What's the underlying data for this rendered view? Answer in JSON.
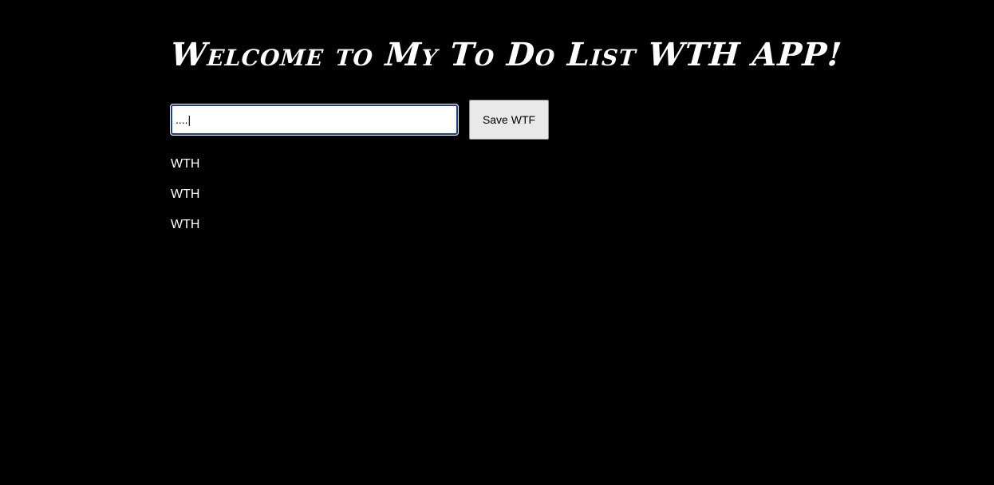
{
  "header": {
    "title": "Welcome to My To Do List WTH APP!"
  },
  "form": {
    "input_value": "....|",
    "save_label": "Save WTF"
  },
  "todos": [
    {
      "text": "WTH"
    },
    {
      "text": "WTH"
    },
    {
      "text": "WTH"
    }
  ],
  "colors": {
    "background": "#000000",
    "text": "#ffffff",
    "input_focus_border": "#1a3c9c",
    "button_background": "#e9e9e9"
  }
}
